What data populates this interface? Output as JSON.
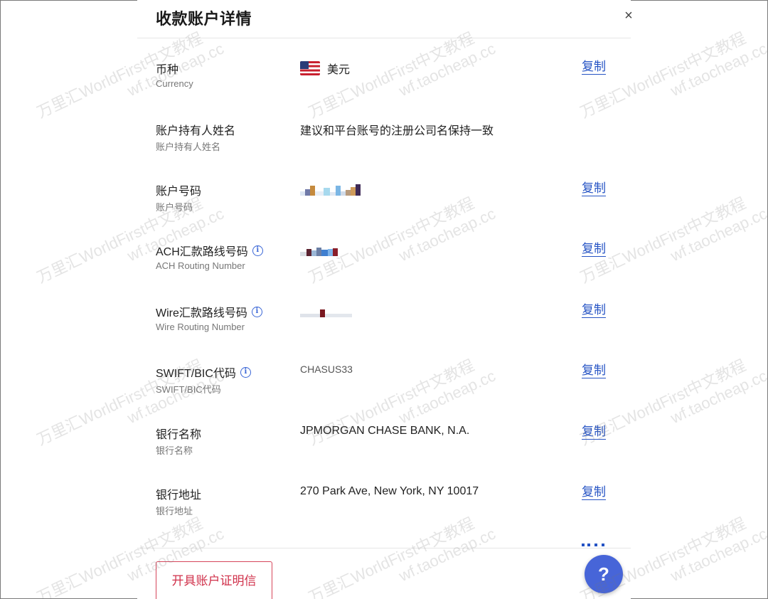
{
  "modal": {
    "title": "收款账户详情",
    "close_label": "×"
  },
  "rows": [
    {
      "label_zh": "币种",
      "label_en": "Currency",
      "value": "美元",
      "icon": "us-flag-icon",
      "copy_label": "复制"
    },
    {
      "label_zh": "账户持有人姓名",
      "label_en": "账户持有人姓名",
      "value": "建议和平台账号的注册公司名保持一致"
    },
    {
      "label_zh": "账户号码",
      "label_en": "账户号码",
      "value": "",
      "copy_label": "复制"
    },
    {
      "label_zh": "ACH汇款路线号码",
      "label_en": "ACH Routing Number",
      "value": "",
      "info_icon": "i",
      "copy_label": "复制"
    },
    {
      "label_zh": "Wire汇款路线号码",
      "label_en": "Wire Routing Number",
      "value": "",
      "info_icon": "i",
      "copy_label": "复制"
    },
    {
      "label_zh": "SWIFT/BIC代码",
      "label_en": "SWIFT/BIC代码",
      "value": "CHASUS33",
      "info_icon": "i",
      "copy_label": "复制"
    },
    {
      "label_zh": "银行名称",
      "label_en": "银行名称",
      "value": "JPMORGAN CHASE BANK, N.A.",
      "copy_label": "复制"
    },
    {
      "label_zh": "银行地址",
      "label_en": "银行地址",
      "value": "270 Park Ave, New York, NY 10017",
      "copy_label": "复制"
    }
  ],
  "footer": {
    "certificate_button": "开具账户证明信"
  },
  "help": {
    "label": "?"
  },
  "watermark": {
    "line1": "万里汇WorldFirst中文教程",
    "line2": "wf.taocheap.cc"
  },
  "colors": {
    "link": "#2553c4",
    "accent_red": "#d0304a",
    "help_fab": "#4765d8"
  }
}
